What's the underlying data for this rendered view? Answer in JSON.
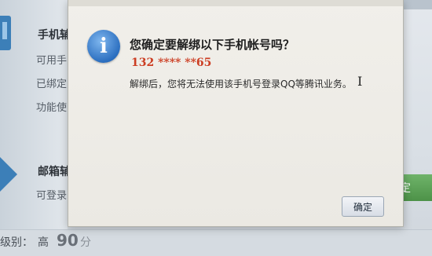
{
  "background": {
    "phone_section": {
      "title": "手机辅",
      "lines": [
        "可用手",
        "已绑定",
        "功能使"
      ]
    },
    "email_section": {
      "title": "邮箱辅",
      "line": "可登录"
    },
    "right_button_label": "定",
    "security_score": {
      "label": "级别：",
      "level": "高",
      "value": "90",
      "unit": "分"
    }
  },
  "dialog": {
    "icon": "info-icon",
    "icon_glyph": "i",
    "title": "您确定要解绑以下手机帐号吗？",
    "phone_number": "132 **** **65",
    "message": "解绑后，您将无法使用该手机号登录QQ等腾讯业务。",
    "cursor_glyph": "I",
    "confirm_label": "确定"
  },
  "colors": {
    "phone_number": "#cc3d22",
    "info_icon": "#2c6fc0",
    "dialog_bg": "#efede8"
  }
}
